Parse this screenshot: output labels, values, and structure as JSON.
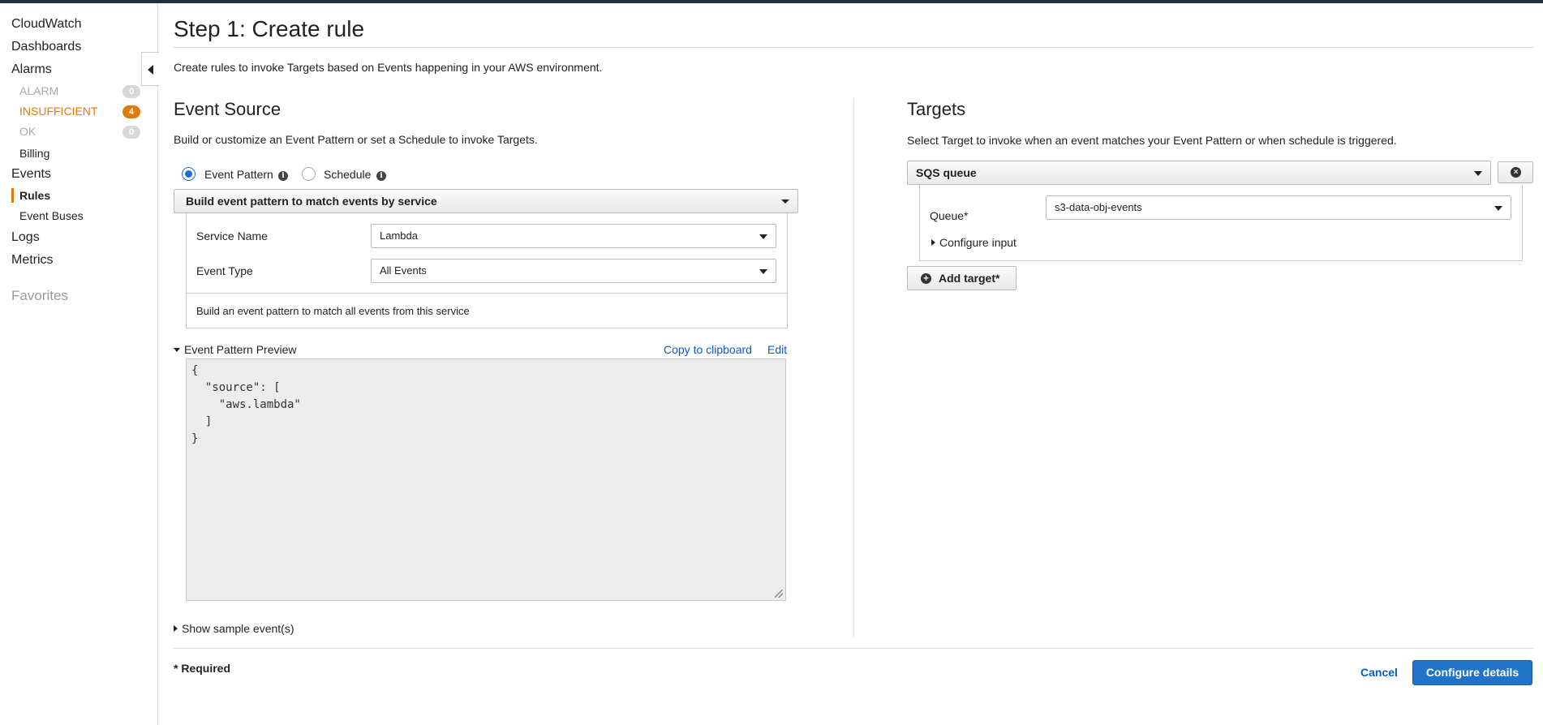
{
  "sidebar": {
    "cloudwatch": "CloudWatch",
    "dashboards": "Dashboards",
    "alarms": "Alarms",
    "alarm_sub": [
      {
        "label": "ALARM",
        "count": "0"
      },
      {
        "label": "INSUFFICIENT",
        "count": "4"
      },
      {
        "label": "OK",
        "count": "0"
      }
    ],
    "billing": "Billing",
    "events": "Events",
    "rules": "Rules",
    "event_buses": "Event Buses",
    "logs": "Logs",
    "metrics": "Metrics",
    "favorites": "Favorites"
  },
  "page": {
    "title": "Step 1: Create rule",
    "description": "Create rules to invoke Targets based on Events happening in your AWS environment."
  },
  "event_source": {
    "heading": "Event Source",
    "subtitle": "Build or customize an Event Pattern or set a Schedule to invoke Targets.",
    "radio_event_pattern": "Event Pattern",
    "radio_schedule": "Schedule",
    "selected_mode": "Event Pattern",
    "builder_select": "Build event pattern to match events by service",
    "service_name_label": "Service Name",
    "service_name_value": "Lambda",
    "event_type_label": "Event Type",
    "event_type_value": "All Events",
    "builder_help": "Build an event pattern to match all events from this service",
    "preview_label": "Event Pattern Preview",
    "copy_link": "Copy to clipboard",
    "edit_link": "Edit",
    "pattern_json": "{\n  \"source\": [\n    \"aws.lambda\"\n  ]\n}",
    "show_sample": "Show sample event(s)"
  },
  "targets": {
    "heading": "Targets",
    "subtitle": "Select Target to invoke when an event matches your Event Pattern or when schedule is triggered.",
    "target_type": "SQS queue",
    "queue_label": "Queue*",
    "queue_value": "s3-data-obj-events",
    "configure_input": "Configure input",
    "add_target": "Add target*"
  },
  "footer": {
    "required_note": "* Required",
    "cancel": "Cancel",
    "configure_details": "Configure details"
  },
  "colors": {
    "accent": "#e07b0b",
    "primary": "#1f73c8",
    "link": "#0a58ca",
    "topbar": "#232f3e"
  }
}
